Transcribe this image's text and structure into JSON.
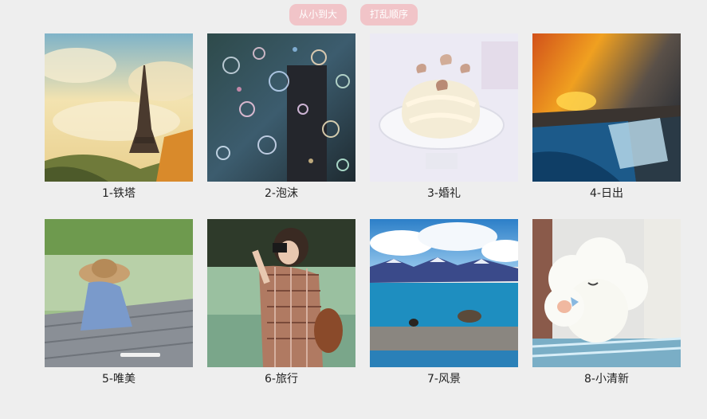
{
  "toolbar": {
    "sort_label": "从小到大",
    "shuffle_label": "打乱顺序"
  },
  "gallery": {
    "items": [
      {
        "caption": "1-铁塔",
        "scene": "eiffel-tower"
      },
      {
        "caption": "2-泡沫",
        "scene": "bubbles"
      },
      {
        "caption": "3-婚礼",
        "scene": "wedding-cake"
      },
      {
        "caption": "4-日出",
        "scene": "sunrise-waterfall"
      },
      {
        "caption": "5-唯美",
        "scene": "girl-on-pier"
      },
      {
        "caption": "6-旅行",
        "scene": "girl-with-camera"
      },
      {
        "caption": "7-风景",
        "scene": "mountain-lake"
      },
      {
        "caption": "8-小清新",
        "scene": "cloud-plush"
      }
    ]
  },
  "colors": {
    "button_bg": "#f1c4c8",
    "button_text": "#ffffff",
    "page_bg": "#eeeeee"
  }
}
